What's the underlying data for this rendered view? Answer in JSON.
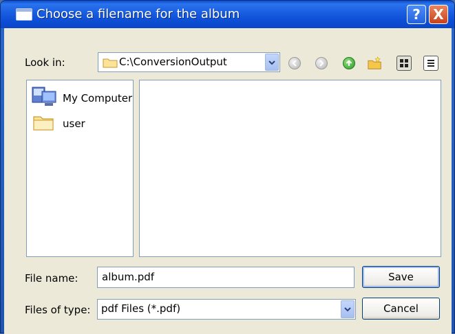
{
  "dialog": {
    "title": "Choose a filename for the album"
  },
  "titlebar": {
    "help_label": "?",
    "close_label": "X"
  },
  "look_in": {
    "label": "Look in:",
    "value": "C:\\ConversionOutput"
  },
  "toolbar": {
    "icons": [
      "back-icon",
      "forward-icon",
      "up-folder-icon",
      "new-folder-icon",
      "detail-view-icon",
      "list-view-icon"
    ]
  },
  "places": {
    "items": [
      {
        "label": "My Computer",
        "icon": "computer-icon"
      },
      {
        "label": "user",
        "icon": "folder-icon"
      }
    ]
  },
  "file_name": {
    "label": "File name:",
    "value": "album.pdf"
  },
  "file_type": {
    "label": "Files of type:",
    "value": "pdf Files (*.pdf)"
  },
  "buttons": {
    "save": "Save",
    "cancel": "Cancel"
  },
  "colors": {
    "titlebar": "#0d4fd7",
    "client": "#ece9d8",
    "close": "#c8411b",
    "field_border": "#7f9db9"
  }
}
